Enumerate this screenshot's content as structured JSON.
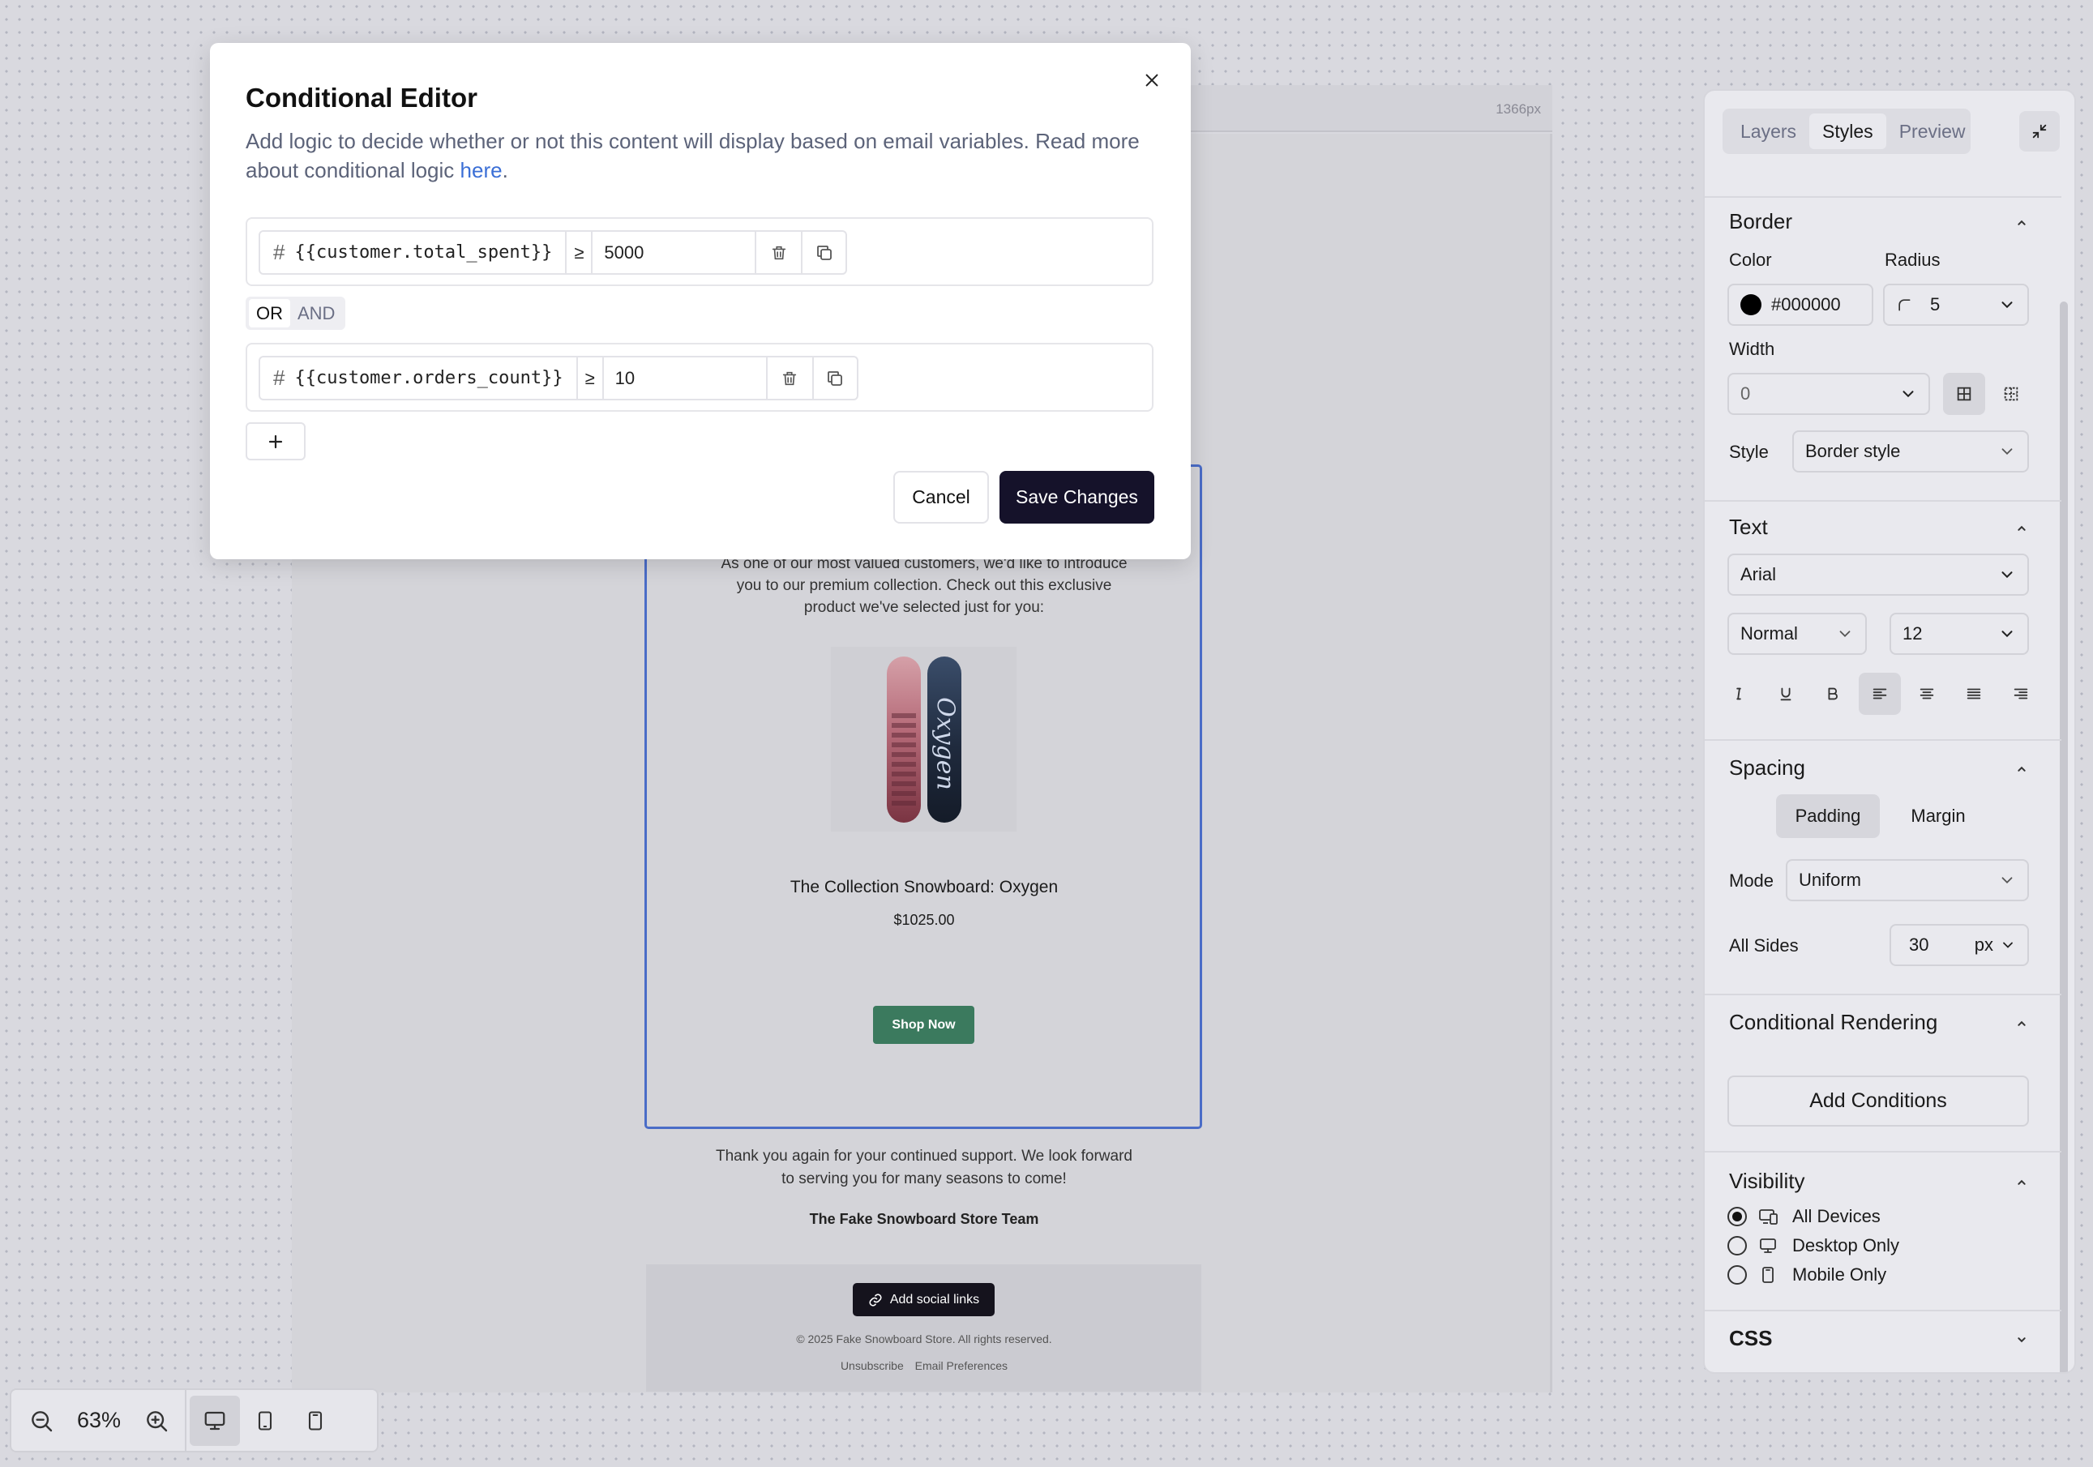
{
  "canvas": {
    "width_label": "1366px",
    "email": {
      "intro": "As one of our most valued customers, we'd like to introduce you to our premium collection. Check out this exclusive product we've selected just for you:",
      "product_title": "The Collection Snowboard: Oxygen",
      "product_price": "$1025.00",
      "shop_button": "Shop Now",
      "thanks": "Thank you again for your continued support. We look forward to serving you for many seasons to come!",
      "signature": "The Fake Snowboard Store Team",
      "social_button": "Add social links",
      "copyright": "© 2025 Fake Snowboard Store. All rights reserved.",
      "footer_links": [
        "Unsubscribe",
        "Email Preferences"
      ]
    }
  },
  "toolbar": {
    "zoom_level": "63%",
    "icons": [
      "zoom-out-icon",
      "zoom-in-icon",
      "desktop-icon",
      "tablet-icon",
      "mobile-icon"
    ]
  },
  "panel": {
    "tabs": [
      "Layers",
      "Styles",
      "Preview"
    ],
    "active_tab": "Styles",
    "border": {
      "title": "Border",
      "color_label": "Color",
      "color_value": "#000000",
      "radius_label": "Radius",
      "radius_value": "5",
      "width_label": "Width",
      "width_value": "0",
      "style_label": "Style",
      "style_value": "Border style"
    },
    "text": {
      "title": "Text",
      "font": "Arial",
      "weight": "Normal",
      "size": "12"
    },
    "spacing": {
      "title": "Spacing",
      "padding_label": "Padding",
      "margin_label": "Margin",
      "mode_label": "Mode",
      "mode_value": "Uniform",
      "all_sides_label": "All Sides",
      "all_sides_value": "30",
      "unit": "px"
    },
    "conditional": {
      "title": "Conditional Rendering",
      "add_button": "Add Conditions"
    },
    "visibility": {
      "title": "Visibility",
      "options": [
        "All Devices",
        "Desktop Only",
        "Mobile Only"
      ],
      "selected": "All Devices"
    },
    "css": {
      "title": "CSS"
    }
  },
  "modal": {
    "title": "Conditional Editor",
    "description": "Add logic to decide whether or not this content will display based on email variables. Read more about conditional logic ",
    "link_text": "here",
    "period": ".",
    "conditions": [
      {
        "variable": "{{customer.total_spent}}",
        "operator": "≥",
        "value": "5000"
      },
      {
        "variable": "{{customer.orders_count}}",
        "operator": "≥",
        "value": "10"
      }
    ],
    "logic": {
      "or_label": "OR",
      "and_label": "AND",
      "selected": "OR"
    },
    "cancel_label": "Cancel",
    "save_label": "Save Changes"
  }
}
